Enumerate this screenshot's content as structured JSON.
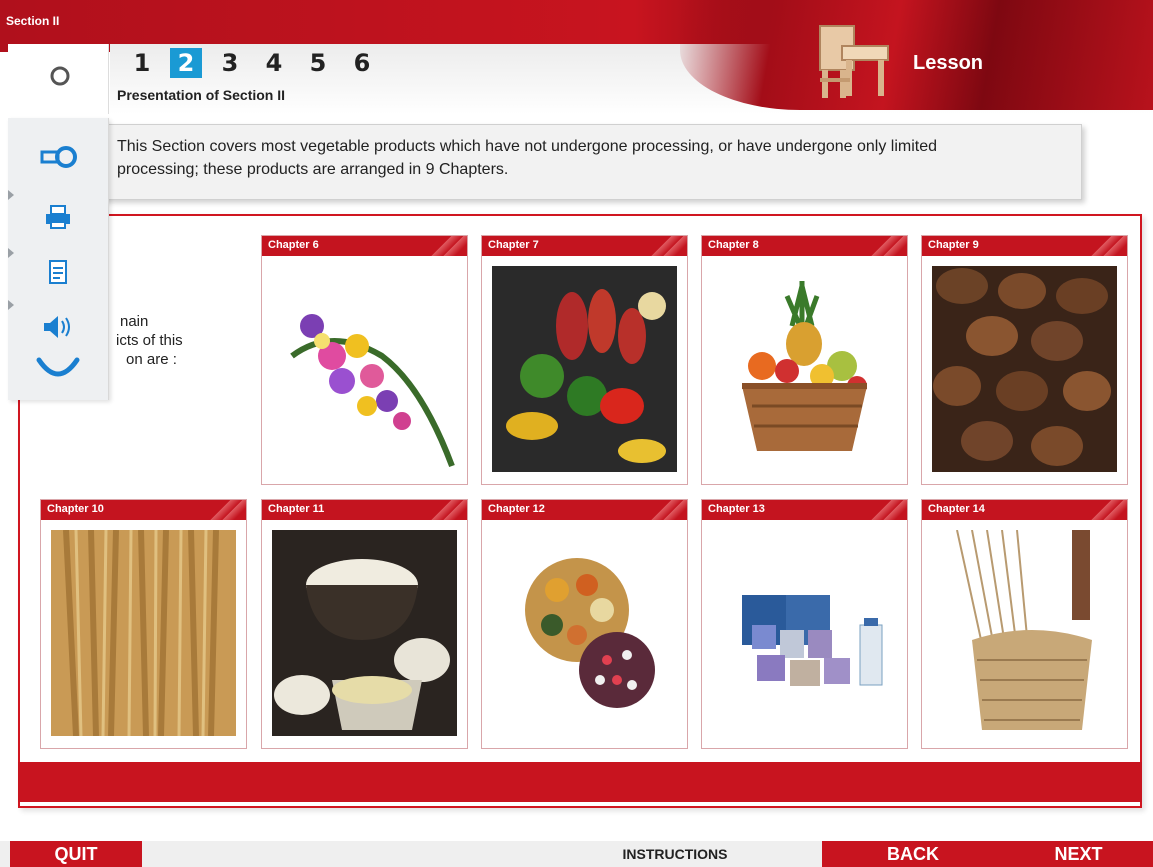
{
  "header": {
    "section_label": "Section II",
    "lesson_label": "Lesson",
    "page_numbers": [
      "1",
      "2",
      "3",
      "4",
      "5",
      "6"
    ],
    "active_page": "2",
    "presentation_title": "Presentation of Section II"
  },
  "description": "This Section covers most vegetable products which have not undergone processing, or have undergone only limited processing; these products are arranged in 9 Chapters.",
  "intro_partial": {
    "line1": "nain",
    "line2": "icts of this",
    "line3": "on are :"
  },
  "chapters": [
    {
      "label": "Chapter 6",
      "image": "flowers-bouquet"
    },
    {
      "label": "Chapter 7",
      "image": "vegetables"
    },
    {
      "label": "Chapter 8",
      "image": "fruit-basket"
    },
    {
      "label": "Chapter 9",
      "image": "coffee-beans"
    },
    {
      "label": "Chapter 10",
      "image": "wheat"
    },
    {
      "label": "Chapter 11",
      "image": "flour"
    },
    {
      "label": "Chapter 12",
      "image": "seeds"
    },
    {
      "label": "Chapter 13",
      "image": "gums-extracts"
    },
    {
      "label": "Chapter 14",
      "image": "plaiting-materials"
    }
  ],
  "footer": {
    "quit": "QUIT",
    "instructions": "INSTRUCTIONS",
    "back": "BACK",
    "next": "NEXT"
  },
  "colors": {
    "brand_red": "#c8141f",
    "active_blue": "#1a9ad4",
    "toolbar_icon": "#1a7fd0"
  },
  "toolbar_icons": [
    "glossary-icon",
    "print-icon",
    "notes-icon",
    "audio-icon",
    "undo-icon"
  ]
}
